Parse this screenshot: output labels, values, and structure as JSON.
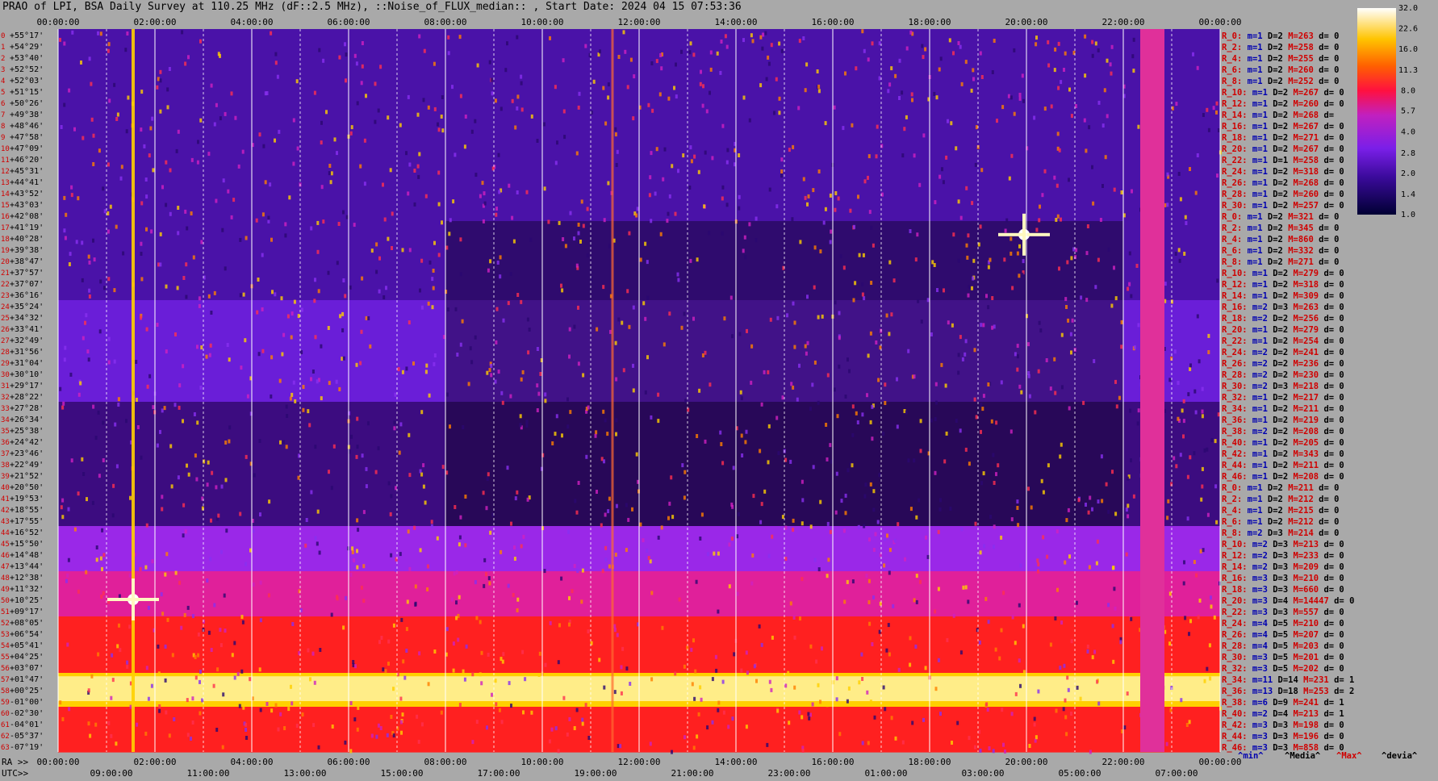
{
  "title": "PRAO of LPI, BSA Daily Survey at 110.25 MHz (dF::2.5 MHz), ::Noise_of_FLUX_median:: , Start Date: 2024 04 15 07:53:36",
  "colors": {
    "background": "#a9a9a9",
    "label_red": "#d00000",
    "label_blue": "#0000b0",
    "grid": "#ffffff"
  },
  "chart_data": {
    "type": "heatmap",
    "title": "PRAO of LPI, BSA Daily Survey at 110.25 MHz (dF::2.5 MHz), ::Noise_of_FLUX_median:: , Start Date: 2024 04 15 07:53:36",
    "x_top_ticks": [
      "00:00:00",
      "02:00:00",
      "04:00:00",
      "06:00:00",
      "08:00:00",
      "10:00:00",
      "12:00:00",
      "14:00:00",
      "16:00:00",
      "18:00:00",
      "20:00:00",
      "22:00:00",
      "00:00:00"
    ],
    "x_ra_prefix": "RA >>",
    "x_ra_ticks": [
      "00:00:00",
      "02:00:00",
      "04:00:00",
      "06:00:00",
      "08:00:00",
      "10:00:00",
      "12:00:00",
      "14:00:00",
      "16:00:00",
      "18:00:00",
      "20:00:00",
      "22:00:00",
      "00:00:00"
    ],
    "x_utc_prefix": "UTC>>",
    "x_utc_ticks": [
      "09:00:00",
      "11:00:00",
      "13:00:00",
      "15:00:00",
      "17:00:00",
      "19:00:00",
      "21:00:00",
      "23:00:00",
      "01:00:00",
      "03:00:00",
      "05:00:00",
      "07:00:00"
    ],
    "y_labels": [
      "+55°17'",
      "+54°29'",
      "+53°40'",
      "+52°52'",
      "+52°03'",
      "+51°15'",
      "+50°26'",
      "+49°38'",
      "+48°46'",
      "+47°58'",
      "+47°09'",
      "+46°20'",
      "+45°31'",
      "+44°41'",
      "+43°52'",
      "+43°03'",
      "+42°08'",
      "+41°19'",
      "+40°28'",
      "+39°38'",
      "+38°47'",
      "+37°57'",
      "+37°07'",
      "+36°16'",
      "+35°24'",
      "+34°32'",
      "+33°41'",
      "+32°49'",
      "+31°56'",
      "+31°04'",
      "+30°10'",
      "+29°17'",
      "+28°22'",
      "+27°28'",
      "+26°34'",
      "+25°38'",
      "+24°42'",
      "+23°46'",
      "+22°49'",
      "+21°52'",
      "+20°50'",
      "+19°53'",
      "+18°55'",
      "+17°55'",
      "+16°52'",
      "+15°50'",
      "+14°48'",
      "+13°44'",
      "+12°38'",
      "+11°32'",
      "+10°25'",
      "+09°17'",
      "+08°05'",
      "+06°54'",
      "+05°41'",
      "+04°25'",
      "+03°07'",
      "+01°47'",
      "+00°25'",
      "-01°00'",
      "-02°30'",
      "-04°01'",
      "-05°37'",
      "-07°19'"
    ],
    "rows": [
      {
        "r": "R_0:",
        "m": "m=1",
        "D": "D=2",
        "M": "M=263",
        "d": "d= 0"
      },
      {
        "r": "R_2:",
        "m": "m=1",
        "D": "D=2",
        "M": "M=258",
        "d": "d= 0"
      },
      {
        "r": "R_4:",
        "m": "m=1",
        "D": "D=2",
        "M": "M=255",
        "d": "d= 0"
      },
      {
        "r": "R_6:",
        "m": "m=1",
        "D": "D=2",
        "M": "M=260",
        "d": "d= 0"
      },
      {
        "r": "R_8:",
        "m": "m=1",
        "D": "D=2",
        "M": "M=252",
        "d": "d= 0"
      },
      {
        "r": "R_10:",
        "m": "m=1",
        "D": "D=2",
        "M": "M=267",
        "d": "d= 0"
      },
      {
        "r": "R_12:",
        "m": "m=1",
        "D": "D=2",
        "M": "M=260",
        "d": "d= 0"
      },
      {
        "r": "R_14:",
        "m": "m=1",
        "D": "D=2",
        "M": "M=268",
        "d": "d="
      },
      {
        "r": "R_16:",
        "m": "m=1",
        "D": "D=2",
        "M": "M=267",
        "d": "d= 0"
      },
      {
        "r": "R_18:",
        "m": "m=1",
        "D": "D=2",
        "M": "M=271",
        "d": "d= 0"
      },
      {
        "r": "R_20:",
        "m": "m=1",
        "D": "D=2",
        "M": "M=267",
        "d": "d= 0"
      },
      {
        "r": "R_22:",
        "m": "m=1",
        "D": "D=1",
        "M": "M=258",
        "d": "d= 0"
      },
      {
        "r": "R_24:",
        "m": "m=1",
        "D": "D=2",
        "M": "M=318",
        "d": "d= 0"
      },
      {
        "r": "R_26:",
        "m": "m=1",
        "D": "D=2",
        "M": "M=268",
        "d": "d= 0"
      },
      {
        "r": "R_28:",
        "m": "m=1",
        "D": "D=2",
        "M": "M=260",
        "d": "d= 0"
      },
      {
        "r": "R_30:",
        "m": "m=1",
        "D": "D=2",
        "M": "M=257",
        "d": "d= 0"
      },
      {
        "r": "R_0:",
        "m": "m=1",
        "D": "D=2",
        "M": "M=321",
        "d": "d= 0"
      },
      {
        "r": "R_2:",
        "m": "m=1",
        "D": "D=2",
        "M": "M=345",
        "d": "d= 0"
      },
      {
        "r": "R_4:",
        "m": "m=1",
        "D": "D=2",
        "M": "M=860",
        "d": "d= 0"
      },
      {
        "r": "R_6:",
        "m": "m=1",
        "D": "D=2",
        "M": "M=332",
        "d": "d= 0"
      },
      {
        "r": "R_8:",
        "m": "m=1",
        "D": "D=2",
        "M": "M=271",
        "d": "d= 0"
      },
      {
        "r": "R_10:",
        "m": "m=1",
        "D": "D=2",
        "M": "M=279",
        "d": "d= 0"
      },
      {
        "r": "R_12:",
        "m": "m=1",
        "D": "D=2",
        "M": "M=318",
        "d": "d= 0"
      },
      {
        "r": "R_14:",
        "m": "m=1",
        "D": "D=2",
        "M": "M=309",
        "d": "d= 0"
      },
      {
        "r": "R_16:",
        "m": "m=2",
        "D": "D=3",
        "M": "M=263",
        "d": "d= 0"
      },
      {
        "r": "R_18:",
        "m": "m=2",
        "D": "D=2",
        "M": "M=256",
        "d": "d= 0"
      },
      {
        "r": "R_20:",
        "m": "m=1",
        "D": "D=2",
        "M": "M=279",
        "d": "d= 0"
      },
      {
        "r": "R_22:",
        "m": "m=1",
        "D": "D=2",
        "M": "M=254",
        "d": "d= 0"
      },
      {
        "r": "R_24:",
        "m": "m=2",
        "D": "D=2",
        "M": "M=241",
        "d": "d= 0"
      },
      {
        "r": "R_26:",
        "m": "m=2",
        "D": "D=2",
        "M": "M=236",
        "d": "d= 0"
      },
      {
        "r": "R_28:",
        "m": "m=2",
        "D": "D=2",
        "M": "M=230",
        "d": "d= 0"
      },
      {
        "r": "R_30:",
        "m": "m=2",
        "D": "D=3",
        "M": "M=218",
        "d": "d= 0"
      },
      {
        "r": "R_32:",
        "m": "m=1",
        "D": "D=2",
        "M": "M=217",
        "d": "d= 0"
      },
      {
        "r": "R_34:",
        "m": "m=1",
        "D": "D=2",
        "M": "M=211",
        "d": "d= 0"
      },
      {
        "r": "R_36:",
        "m": "m=1",
        "D": "D=2",
        "M": "M=219",
        "d": "d= 0"
      },
      {
        "r": "R_38:",
        "m": "m=2",
        "D": "D=2",
        "M": "M=208",
        "d": "d= 0"
      },
      {
        "r": "R_40:",
        "m": "m=1",
        "D": "D=2",
        "M": "M=205",
        "d": "d= 0"
      },
      {
        "r": "R_42:",
        "m": "m=1",
        "D": "D=2",
        "M": "M=343",
        "d": "d= 0"
      },
      {
        "r": "R_44:",
        "m": "m=1",
        "D": "D=2",
        "M": "M=211",
        "d": "d= 0"
      },
      {
        "r": "R_46:",
        "m": "m=1",
        "D": "D=2",
        "M": "M=208",
        "d": "d= 0"
      },
      {
        "r": "R_0:",
        "m": "m=1",
        "D": "D=2",
        "M": "M=211",
        "d": "d= 0"
      },
      {
        "r": "R_2:",
        "m": "m=1",
        "D": "D=2",
        "M": "M=212",
        "d": "d= 0"
      },
      {
        "r": "R_4:",
        "m": "m=1",
        "D": "D=2",
        "M": "M=215",
        "d": "d= 0"
      },
      {
        "r": "R_6:",
        "m": "m=1",
        "D": "D=2",
        "M": "M=212",
        "d": "d= 0"
      },
      {
        "r": "R_8:",
        "m": "m=2",
        "D": "D=3",
        "M": "M=214",
        "d": "d= 0"
      },
      {
        "r": "R_10:",
        "m": "m=2",
        "D": "D=3",
        "M": "M=213",
        "d": "d= 0"
      },
      {
        "r": "R_12:",
        "m": "m=2",
        "D": "D=3",
        "M": "M=233",
        "d": "d= 0"
      },
      {
        "r": "R_14:",
        "m": "m=2",
        "D": "D=3",
        "M": "M=209",
        "d": "d= 0"
      },
      {
        "r": "R_16:",
        "m": "m=3",
        "D": "D=3",
        "M": "M=210",
        "d": "d= 0"
      },
      {
        "r": "R_18:",
        "m": "m=3",
        "D": "D=3",
        "M": "M=660",
        "d": "d= 0"
      },
      {
        "r": "R_20:",
        "m": "m=3",
        "D": "D=4",
        "M": "M=14447",
        "d": "d= 0"
      },
      {
        "r": "R_22:",
        "m": "m=3",
        "D": "D=3",
        "M": "M=557",
        "d": "d= 0"
      },
      {
        "r": "R_24:",
        "m": "m=4",
        "D": "D=5",
        "M": "M=210",
        "d": "d= 0"
      },
      {
        "r": "R_26:",
        "m": "m=4",
        "D": "D=5",
        "M": "M=207",
        "d": "d= 0"
      },
      {
        "r": "R_28:",
        "m": "m=4",
        "D": "D=5",
        "M": "M=203",
        "d": "d= 0"
      },
      {
        "r": "R_30:",
        "m": "m=3",
        "D": "D=5",
        "M": "M=201",
        "d": "d= 0"
      },
      {
        "r": "R_32:",
        "m": "m=3",
        "D": "D=5",
        "M": "M=202",
        "d": "d= 0"
      },
      {
        "r": "R_34:",
        "m": "m=11",
        "D": "D=14",
        "M": "M=231",
        "d": "d= 1"
      },
      {
        "r": "R_36:",
        "m": "m=13",
        "D": "D=18",
        "M": "M=253",
        "d": "d= 2"
      },
      {
        "r": "R_38:",
        "m": "m=6",
        "D": "D=9",
        "M": "M=241",
        "d": "d= 1"
      },
      {
        "r": "R_40:",
        "m": "m=2",
        "D": "D=4",
        "M": "M=213",
        "d": "d= 1"
      },
      {
        "r": "R_42:",
        "m": "m=3",
        "D": "D=3",
        "M": "M=198",
        "d": "d= 0"
      },
      {
        "r": "R_44:",
        "m": "m=3",
        "D": "D=3",
        "M": "M=196",
        "d": "d= 0"
      },
      {
        "r": "R_46:",
        "m": "m=3",
        "D": "D=3",
        "M": "M=858",
        "d": "d= 0"
      }
    ],
    "footer_labels": [
      "^min^",
      "^Media^",
      "^Max^",
      "^devia^"
    ],
    "colorbar": {
      "ticks": [
        "32.0",
        "22.6",
        "16.0",
        "11.3",
        "8.0",
        "5.7",
        "4.0",
        "2.8",
        "2.0",
        "1.4",
        "1.0"
      ],
      "range": [
        1.0,
        32.0
      ],
      "scale": "log2"
    },
    "sources": [
      {
        "ra_hours": 1.55,
        "dec_row": 50.5,
        "label": ""
      },
      {
        "ra_hours": 19.95,
        "dec_row": 18.2,
        "label": ""
      }
    ],
    "grid": true
  }
}
